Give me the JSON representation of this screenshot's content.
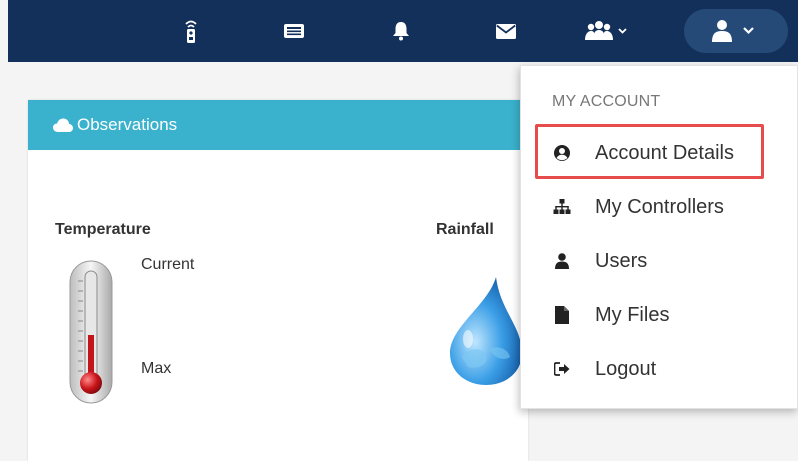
{
  "topbar": {
    "icons": [
      "remote-control-icon",
      "id-card-icon",
      "bell-icon",
      "envelope-icon",
      "users-dropdown-icon",
      "user-dropdown-icon"
    ]
  },
  "panel": {
    "title": "Observations",
    "temperature_label": "Temperature",
    "current_label": "Current",
    "max_label": "Max",
    "rainfall_label": "Rainfall"
  },
  "menu": {
    "header": "MY ACCOUNT",
    "items": [
      {
        "label": "Account Details",
        "icon": "user-circle-icon"
      },
      {
        "label": "My Controllers",
        "icon": "sitemap-icon"
      },
      {
        "label": "Users",
        "icon": "user-icon"
      },
      {
        "label": "My Files",
        "icon": "file-icon"
      },
      {
        "label": "Logout",
        "icon": "sign-out-icon"
      }
    ]
  },
  "colors": {
    "topbar": "#13305a",
    "panel_header": "#3ab2cd",
    "highlight": "#e74c4c"
  }
}
